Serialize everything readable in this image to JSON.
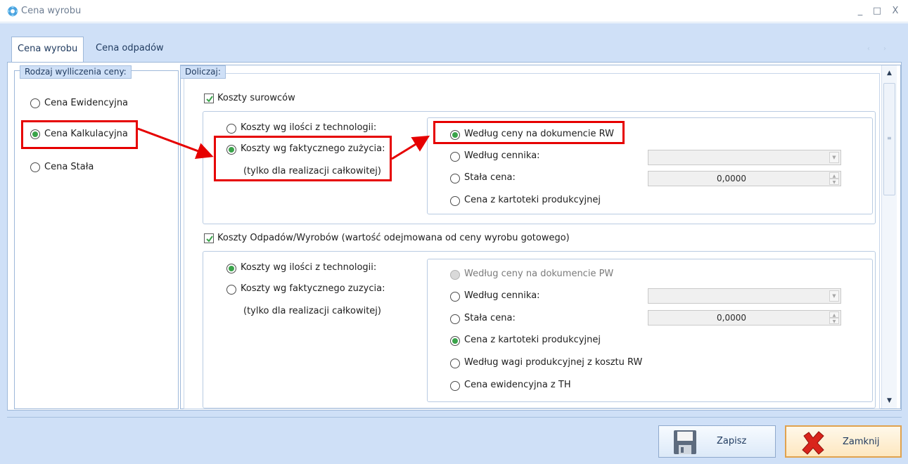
{
  "window": {
    "title": "Cena wyrobu",
    "controls": [
      "_",
      "□",
      "X"
    ]
  },
  "tabs": [
    {
      "label": "Cena wyrobu",
      "active": true
    },
    {
      "label": "Cena odpadów",
      "active": false
    }
  ],
  "tab_arrows": "‹ ›",
  "left_group": {
    "title": "Rodzaj wylliczenia ceny:",
    "options": [
      {
        "label": "Cena Ewidencyjna",
        "selected": false
      },
      {
        "label": "Cena Kalkulacyjna",
        "selected": true
      },
      {
        "label": "Cena Stała",
        "selected": false
      }
    ]
  },
  "right_group": {
    "title": "Doliczaj:",
    "raw": {
      "checkbox_label": "Koszty surowców",
      "checked": true,
      "qty_options": [
        {
          "label": "Koszty wg ilości z technologii:",
          "selected": false
        },
        {
          "label": "Koszty wg faktycznego zużycia:",
          "selected": true
        }
      ],
      "note": "(tylko dla realizacji całkowitej)",
      "price_options": [
        {
          "label": "Według ceny na dokumencie RW",
          "selected": true
        },
        {
          "label": "Według cennika:",
          "selected": false
        },
        {
          "label": "Stała cena:",
          "selected": false
        },
        {
          "label": "Cena z kartoteki produkcyjnej",
          "selected": false
        }
      ],
      "fixed_price_value": "0,0000"
    },
    "waste": {
      "checkbox_label": "Koszty Odpadów/Wyrobów (wartość odejmowana od ceny wyrobu gotowego)",
      "checked": true,
      "qty_options": [
        {
          "label": "Koszty wg ilości z technologii:",
          "selected": true
        },
        {
          "label": "Koszty wg faktycznego zuzycia:",
          "selected": false
        }
      ],
      "note": "(tylko dla realizacji całkowitej)",
      "price_options": [
        {
          "label": "Według ceny na dokumencie PW",
          "selected": false,
          "disabled": true
        },
        {
          "label": "Według cennika:",
          "selected": false
        },
        {
          "label": "Stała cena:",
          "selected": false
        },
        {
          "label": "Cena z kartoteki produkcyjnej",
          "selected": true
        },
        {
          "label": "Według wagi produkcyjnej z kosztu RW",
          "selected": false
        },
        {
          "label": "Cena ewidencyjna z TH",
          "selected": false
        }
      ],
      "fixed_price_value": "0,0000"
    }
  },
  "footer": {
    "save_label": "Zapisz",
    "close_label": "Zamknij"
  },
  "colors": {
    "highlight": "#e60000",
    "radio_selected": "#3aa34a",
    "panel_bg": "#cfe0f7"
  }
}
